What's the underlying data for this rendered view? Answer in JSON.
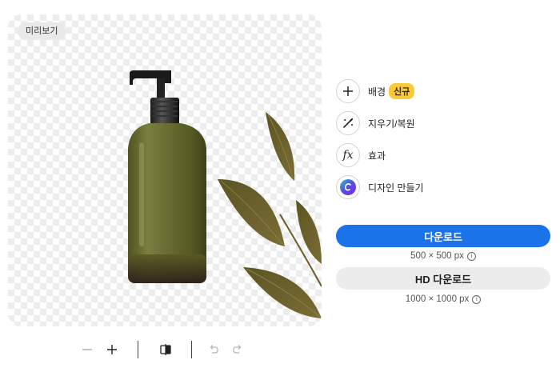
{
  "preview": {
    "badge": "미리보기"
  },
  "options": [
    {
      "name": "add",
      "icon": "plus-icon",
      "label": "배경",
      "badge": "신규"
    },
    {
      "name": "erase-restore",
      "icon": "magic-wand-icon",
      "label": "지우기/복원"
    },
    {
      "name": "effects",
      "icon": "fx-icon",
      "label": "효과"
    },
    {
      "name": "create-design",
      "icon": "canva-logo-icon",
      "label": "디자인 만들기"
    }
  ],
  "download": {
    "label": "다운로드",
    "size": "500 × 500 px"
  },
  "hd_download": {
    "label": "HD 다운로드",
    "size": "1000 × 1000 px"
  },
  "info_glyph": "i",
  "fx_glyph": "fx",
  "colors": {
    "primary": "#1a73e8",
    "badge": "#f9c83b"
  }
}
